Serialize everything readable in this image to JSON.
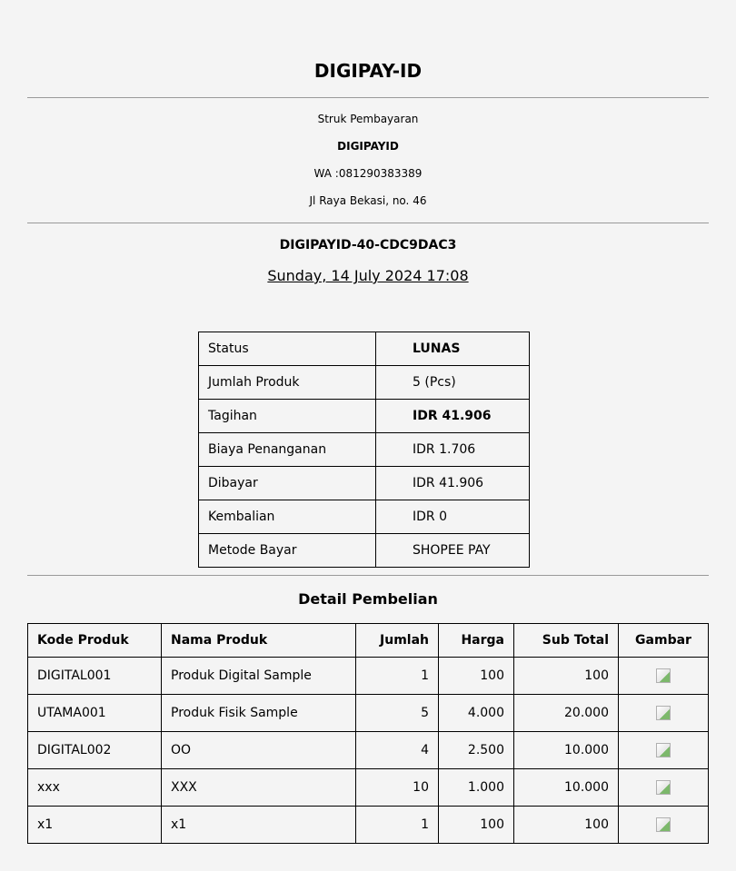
{
  "header": {
    "brand": "DIGIPAY-ID",
    "receipt_label": "Struk Pembayaran",
    "store_name": "DIGIPAYID",
    "whatsapp": "WA :081290383389",
    "address": "Jl Raya Bekasi, no. 46"
  },
  "transaction": {
    "id": "DIGIPAYID-40-CDC9DAC3",
    "date": "Sunday, 14 July 2024 17:08"
  },
  "summary": [
    {
      "label": "Status",
      "value": "LUNAS",
      "bold": true
    },
    {
      "label": "Jumlah Produk",
      "value": "5 (Pcs)",
      "bold": false
    },
    {
      "label": "Tagihan",
      "value": "IDR 41.906",
      "bold": true
    },
    {
      "label": "Biaya Penanganan",
      "value": "IDR 1.706",
      "bold": false
    },
    {
      "label": "Dibayar",
      "value": "IDR 41.906",
      "bold": false
    },
    {
      "label": "Kembalian",
      "value": "IDR 0",
      "bold": false
    },
    {
      "label": "Metode Bayar",
      "value": "SHOPEE PAY",
      "bold": false
    }
  ],
  "details": {
    "title": "Detail Pembelian",
    "columns": [
      "Kode Produk",
      "Nama Produk",
      "Jumlah",
      "Harga",
      "Sub Total",
      "Gambar"
    ],
    "rows": [
      {
        "code": "DIGITAL001",
        "name": "Produk Digital Sample",
        "qty": "1",
        "price": "100",
        "subtotal": "100",
        "image_icon": "broken-image-icon"
      },
      {
        "code": "UTAMA001",
        "name": "Produk Fisik Sample",
        "qty": "5",
        "price": "4.000",
        "subtotal": "20.000",
        "image_icon": "broken-image-icon"
      },
      {
        "code": "DIGITAL002",
        "name": "OO",
        "qty": "4",
        "price": "2.500",
        "subtotal": "10.000",
        "image_icon": "broken-image-icon"
      },
      {
        "code": "xxx",
        "name": "XXX",
        "qty": "10",
        "price": "1.000",
        "subtotal": "10.000",
        "image_icon": "broken-image-icon"
      },
      {
        "code": "x1",
        "name": "x1",
        "qty": "1",
        "price": "100",
        "subtotal": "100",
        "image_icon": "broken-image-icon"
      }
    ]
  }
}
